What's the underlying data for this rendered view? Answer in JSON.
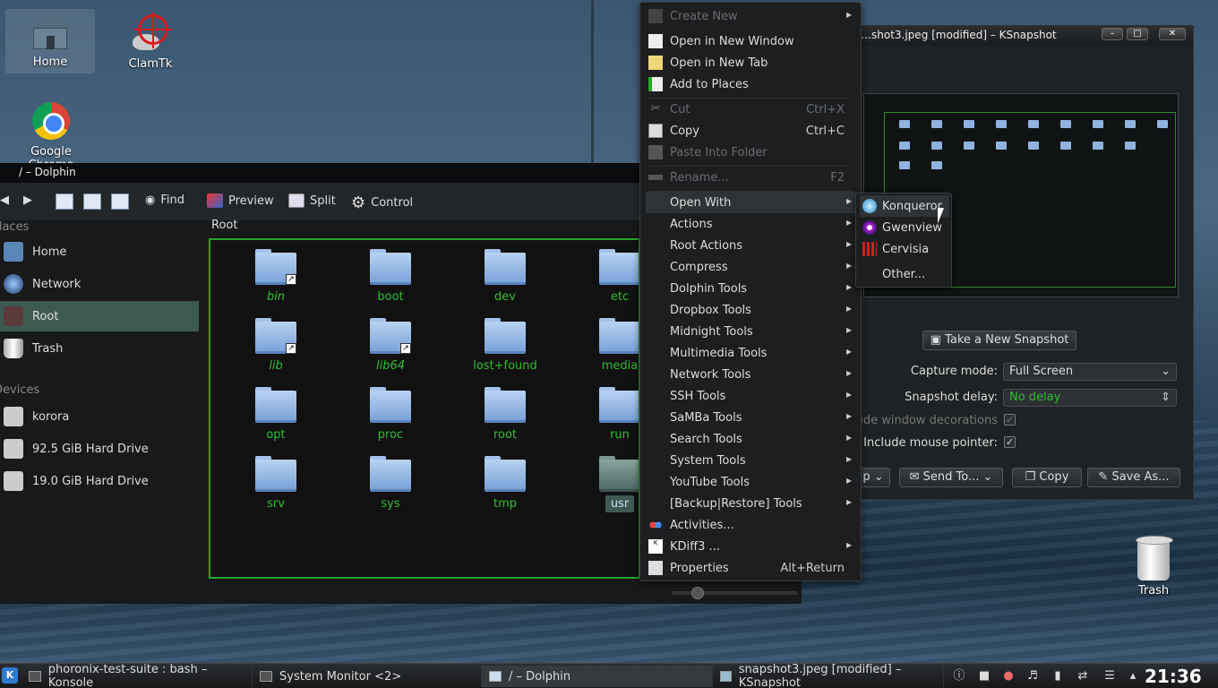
{
  "desktop": {
    "icons": [
      {
        "label": "Home"
      },
      {
        "label": "ClamTk"
      },
      {
        "label": "Google Chrome"
      },
      {
        "label": "Trash"
      }
    ]
  },
  "ksnapshot": {
    "title": "…shot3.jpeg [modified] – KSnapshot",
    "new_snapshot": "Take a New Snapshot",
    "capture_mode_label": "Capture mode:",
    "capture_mode_value": "Full Screen",
    "delay_label": "Snapshot delay:",
    "delay_value": "No delay",
    "decorations_label": "Include window decorations:",
    "pointer_label": "Include mouse pointer:",
    "buttons": {
      "help": "p",
      "send_to": "Send To...",
      "copy": "Copy",
      "save_as": "Save As..."
    }
  },
  "dolphin": {
    "title": "/ – Dolphin",
    "toolbar": {
      "find": "Find",
      "preview": "Preview",
      "split": "Split",
      "control": "Control"
    },
    "places_header": "Places",
    "places": [
      {
        "label": "Home"
      },
      {
        "label": "Network"
      },
      {
        "label": "Root",
        "active": true
      },
      {
        "label": "Trash"
      }
    ],
    "devices_header": "Devices",
    "devices": [
      {
        "label": "korora"
      },
      {
        "label": "92.5 GiB Hard Drive"
      },
      {
        "label": "19.0 GiB Hard Drive"
      }
    ],
    "location": "Root",
    "files": [
      {
        "name": "bin",
        "link": true
      },
      {
        "name": "boot"
      },
      {
        "name": "dev"
      },
      {
        "name": "etc"
      },
      {
        "name": "lib",
        "link": true
      },
      {
        "name": "lib64",
        "link": true
      },
      {
        "name": "lost+found"
      },
      {
        "name": "media"
      },
      {
        "name": "opt"
      },
      {
        "name": "proc"
      },
      {
        "name": "root"
      },
      {
        "name": "run"
      },
      {
        "name": "srv"
      },
      {
        "name": "sys"
      },
      {
        "name": "tmp"
      },
      {
        "name": "usr",
        "selected": true
      }
    ]
  },
  "context_menu": {
    "items": [
      {
        "label": "Create New",
        "disabled": true,
        "submenu": true
      },
      {
        "label": "Open in New Window"
      },
      {
        "label": "Open in New Tab"
      },
      {
        "label": "Add to Places"
      },
      {
        "label": "Cut",
        "shortcut": "Ctrl+X",
        "disabled": true
      },
      {
        "label": "Copy",
        "shortcut": "Ctrl+C"
      },
      {
        "label": "Paste Into Folder",
        "disabled": true
      },
      {
        "label": "Rename...",
        "shortcut": "F2",
        "disabled": true
      },
      {
        "label": "Open With",
        "submenu": true,
        "highlighted": true
      },
      {
        "label": "Actions",
        "submenu": true
      },
      {
        "label": "Root Actions",
        "submenu": true
      },
      {
        "label": "Compress",
        "submenu": true
      },
      {
        "label": "Dolphin Tools",
        "submenu": true
      },
      {
        "label": "Dropbox Tools",
        "submenu": true
      },
      {
        "label": "Midnight Tools",
        "submenu": true
      },
      {
        "label": "Multimedia Tools",
        "submenu": true
      },
      {
        "label": "Network Tools",
        "submenu": true
      },
      {
        "label": "SSH Tools",
        "submenu": true
      },
      {
        "label": "SaMBa Tools",
        "submenu": true
      },
      {
        "label": "Search Tools",
        "submenu": true
      },
      {
        "label": "System Tools",
        "submenu": true
      },
      {
        "label": "YouTube Tools",
        "submenu": true
      },
      {
        "label": "[Backup|Restore] Tools",
        "submenu": true
      },
      {
        "label": "Activities..."
      },
      {
        "label": "KDiff3 ...",
        "submenu": true
      },
      {
        "label": "Properties",
        "shortcut": "Alt+Return"
      }
    ]
  },
  "open_with_submenu": {
    "items": [
      {
        "label": "Konqueror",
        "highlighted": true
      },
      {
        "label": "Gwenview"
      },
      {
        "label": "Cervisia"
      },
      {
        "label": "Other..."
      }
    ]
  },
  "taskbar": {
    "tasks": [
      {
        "label": "phoronix-test-suite : bash – Konsole"
      },
      {
        "label": "System Monitor <2>"
      },
      {
        "label": "/ – Dolphin",
        "active": true
      },
      {
        "label": "snapshot3.jpeg [modified] – KSnapshot"
      }
    ],
    "clock": "21:36"
  }
}
